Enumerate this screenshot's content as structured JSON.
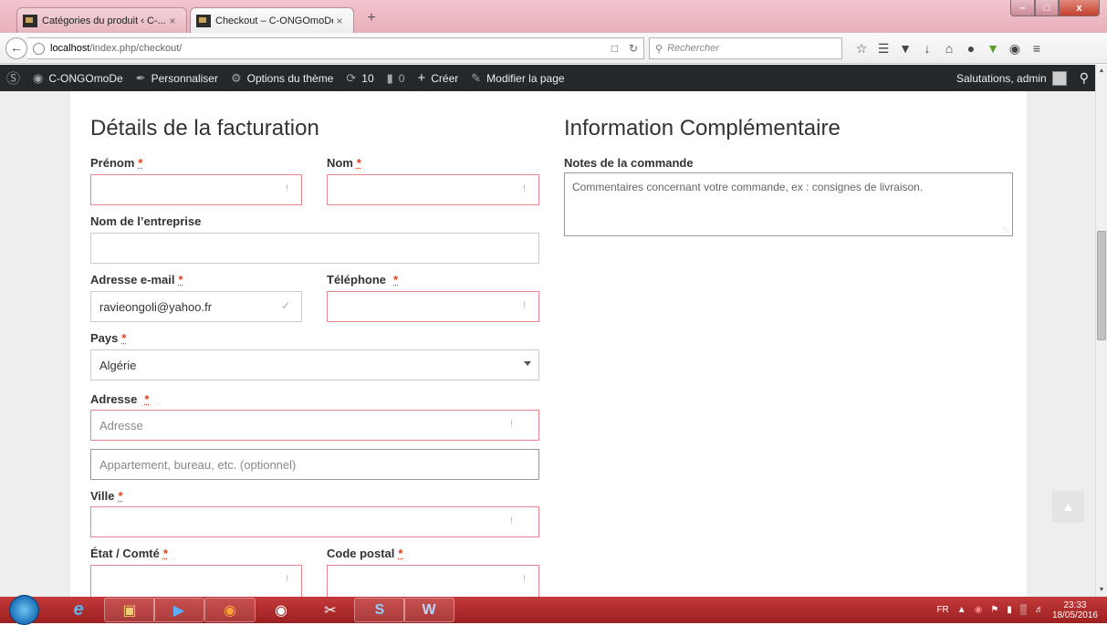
{
  "browser": {
    "tabs": [
      {
        "label": "Catégories du produit ‹ C-...",
        "close": "×"
      },
      {
        "label": "Checkout – C-ONGOmoDe",
        "close": "×"
      }
    ],
    "new_tab": "+",
    "url_host": "localhost",
    "url_path": "/index.php/checkout/",
    "search_placeholder": "Rechercher",
    "window_buttons": {
      "minimize": "–",
      "maximize": "□",
      "close": "x"
    },
    "toolbar_icons": [
      "star-icon",
      "bookmarks-icon",
      "pocket-icon",
      "download-icon",
      "home-icon",
      "chat-icon",
      "addon-icon",
      "shield-icon",
      "menu-icon"
    ]
  },
  "adminbar": {
    "site_name": "C-ONGOmoDe",
    "customize": "Personnaliser",
    "theme_options": "Options du thème",
    "updates_count": "10",
    "comments_count": "0",
    "new": "Créer",
    "edit_page": "Modifier la page",
    "greeting": "Salutations, admin"
  },
  "billing": {
    "title": "Détails de la facturation",
    "required_mark": "*",
    "first_name_label": "Prénom",
    "last_name_label": "Nom",
    "company_label": "Nom de l’entreprise",
    "email_label": "Adresse e-mail",
    "email_value": "ravieongoli@yahoo.fr",
    "phone_label": "Téléphone",
    "country_label": "Pays",
    "country_value": "Algérie",
    "address_label": "Adresse",
    "address_placeholder": "Adresse",
    "address2_placeholder": "Appartement, bureau, etc. (optionnel)",
    "city_label": "Ville",
    "state_label": "État / Comté",
    "postcode_label": "Code postal",
    "invalid_mark": "!"
  },
  "additional": {
    "title": "Information Complémentaire",
    "notes_label": "Notes de la commande",
    "notes_placeholder": "Commentaires concernant votre commande, ex : consignes de livraison."
  },
  "taskbar": {
    "language": "FR",
    "time": "23:33",
    "date": "18/05/2016"
  }
}
